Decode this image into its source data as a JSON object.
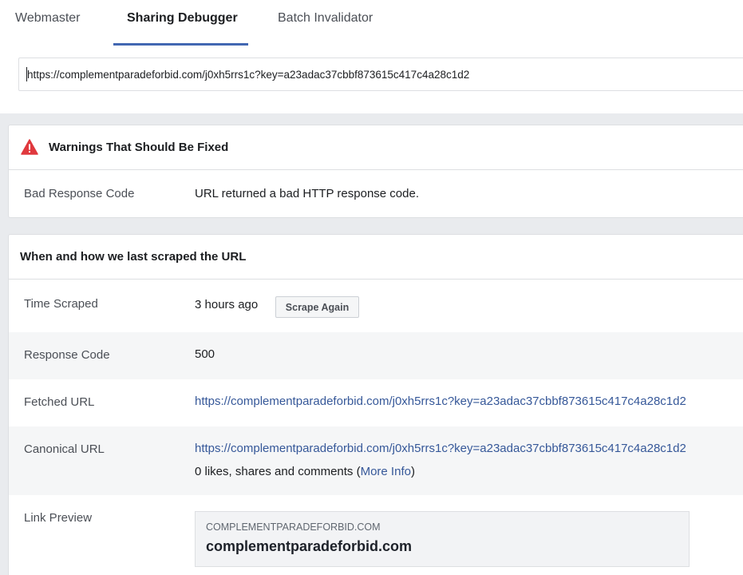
{
  "tabs": [
    {
      "label": "Webmaster",
      "active": false
    },
    {
      "label": "Sharing Debugger",
      "active": true
    },
    {
      "label": "Batch Invalidator",
      "active": false
    }
  ],
  "url_input": {
    "value": "https://complementparadeforbid.com/j0xh5rrs1c?key=a23adac37cbbf873615c417c4a28c1d2"
  },
  "warnings": {
    "icon": "warning-triangle-icon",
    "title": "Warnings That Should Be Fixed",
    "rows": [
      {
        "label": "Bad Response Code",
        "value": "URL returned a bad HTTP response code."
      }
    ]
  },
  "scrape": {
    "title": "When and how we last scraped the URL",
    "time_scraped": {
      "label": "Time Scraped",
      "value": "3 hours ago",
      "button": "Scrape Again"
    },
    "response_code": {
      "label": "Response Code",
      "value": "500"
    },
    "fetched_url": {
      "label": "Fetched URL",
      "value": "https://complementparadeforbid.com/j0xh5rrs1c?key=a23adac37cbbf873615c417c4a28c1d2"
    },
    "canonical_url": {
      "label": "Canonical URL",
      "value": "https://complementparadeforbid.com/j0xh5rrs1c?key=a23adac37cbbf873615c417c4a28c1d2",
      "engagement_text": "0 likes, shares and comments (",
      "more_info": "More Info",
      "engagement_close": ")"
    },
    "link_preview": {
      "label": "Link Preview",
      "domain": "COMPLEMENTPARADEFORBID.COM",
      "title": "complementparadeforbid.com"
    }
  },
  "colors": {
    "accent": "#4267b2",
    "link": "#365899",
    "warning": "#e0393e",
    "background": "#e9ebee"
  }
}
